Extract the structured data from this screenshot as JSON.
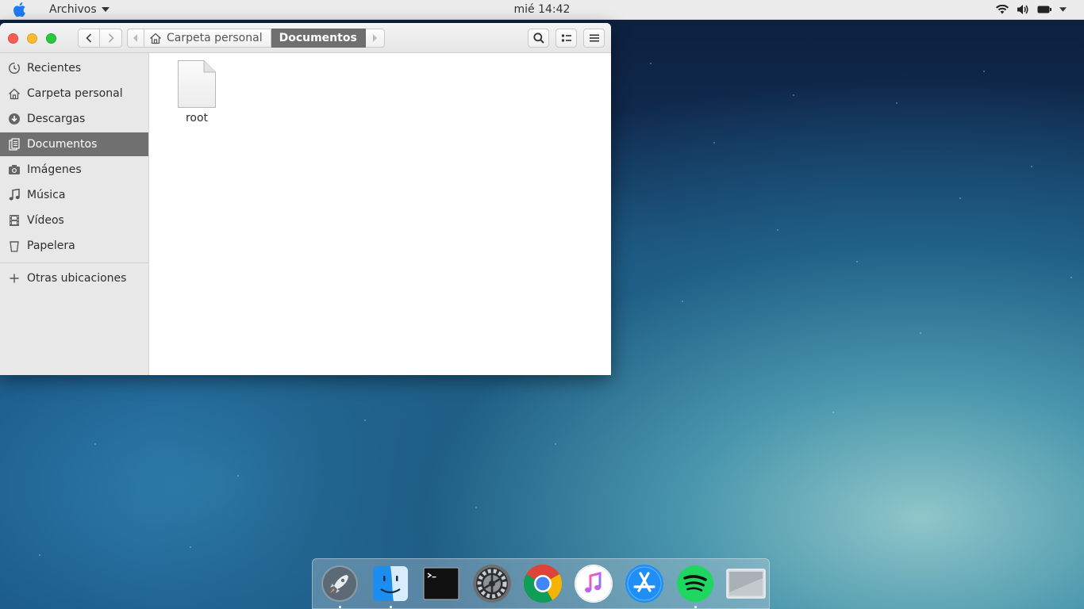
{
  "topbar": {
    "app_menu": "Archivos",
    "clock": "mié 14:42"
  },
  "window": {
    "pathbar": {
      "home_crumb": "Carpeta personal",
      "current_crumb": "Documentos"
    },
    "sidebar": {
      "items": [
        {
          "label": "Recientes",
          "icon": "clock-icon"
        },
        {
          "label": "Carpeta personal",
          "icon": "home-icon"
        },
        {
          "label": "Descargas",
          "icon": "download-icon"
        },
        {
          "label": "Documentos",
          "icon": "documents-icon",
          "active": true
        },
        {
          "label": "Imágenes",
          "icon": "camera-icon"
        },
        {
          "label": "Música",
          "icon": "music-icon"
        },
        {
          "label": "Vídeos",
          "icon": "film-icon"
        },
        {
          "label": "Papelera",
          "icon": "trash-icon"
        }
      ],
      "other_locations": "Otras ubicaciones"
    },
    "files": [
      {
        "name": "root",
        "icon": "file-icon"
      }
    ]
  },
  "dock": {
    "apps": [
      "launchpad",
      "finder",
      "terminal",
      "system-settings",
      "chrome",
      "itunes",
      "app-store",
      "spotify",
      "screen-preview"
    ]
  },
  "colors": {
    "active_sidebar": "#707070",
    "close": "#fd5f57",
    "minimize": "#fdbc2e",
    "maximize": "#28c840"
  }
}
